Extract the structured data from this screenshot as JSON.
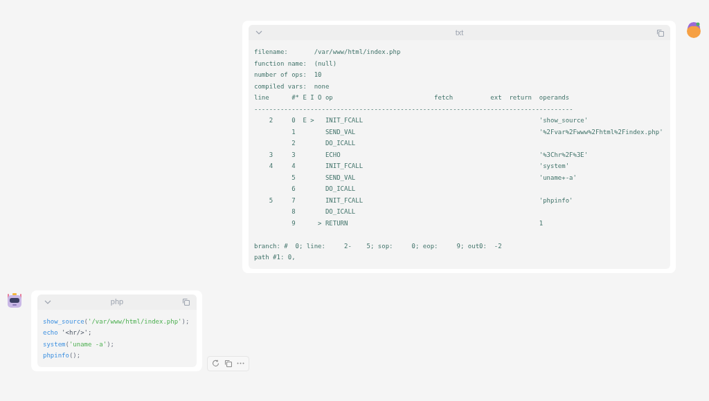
{
  "messages": [
    {
      "kind": "user",
      "code_block": {
        "language": "txt",
        "meta": [
          {
            "key": "filename:",
            "value": "/var/www/html/index.php"
          },
          {
            "key": "function name:",
            "value": "(null)"
          },
          {
            "key": "number of ops:",
            "value": "10"
          },
          {
            "key": "compiled vars:",
            "value": "none"
          }
        ],
        "header": "line      #* E I O op                           fetch          ext  return  operands",
        "rule": "-------------------------------------------------------------------------------------",
        "rows": [
          {
            "line": "2",
            "num": "0",
            "e": "E",
            "i": ">",
            "op": "INIT_FCALL",
            "operands": "'show_source'"
          },
          {
            "num": "1",
            "op": "SEND_VAL",
            "operands": "'%2Fvar%2Fwww%2Fhtml%2Findex.php'"
          },
          {
            "num": "2",
            "op": "DO_ICALL"
          },
          {
            "line": "3",
            "num": "3",
            "op": "ECHO",
            "operands": "'%3Chr%2F%3E'"
          },
          {
            "line": "4",
            "num": "4",
            "op": "INIT_FCALL",
            "operands": "'system'"
          },
          {
            "num": "5",
            "op": "SEND_VAL",
            "operands": "'uname+-a'"
          },
          {
            "num": "6",
            "op": "DO_ICALL"
          },
          {
            "line": "5",
            "num": "7",
            "op": "INIT_FCALL",
            "operands": "'phpinfo'"
          },
          {
            "num": "8",
            "op": "DO_ICALL"
          },
          {
            "num": "9",
            "o": ">",
            "op": "RETURN",
            "operands": "1"
          }
        ],
        "footer": [
          "branch: #  0; line:     2-    5; sop:     0; eop:     9; out0:  -2",
          "path #1: 0,"
        ]
      }
    },
    {
      "kind": "assistant",
      "code_block": {
        "language": "php",
        "lines": [
          [
            {
              "kind": "fn",
              "text": "show_source"
            },
            {
              "kind": "punc",
              "text": "("
            },
            {
              "kind": "str",
              "text": "'/var/www/html/index.php'"
            },
            {
              "kind": "punc",
              "text": ");"
            }
          ],
          [
            {
              "kind": "fn",
              "text": "echo"
            },
            {
              "kind": "plain",
              "text": " '<hr/>';"
            }
          ],
          [
            {
              "kind": "fn",
              "text": "system"
            },
            {
              "kind": "punc",
              "text": "("
            },
            {
              "kind": "str",
              "text": "'uname -a'"
            },
            {
              "kind": "punc",
              "text": ");"
            }
          ],
          [
            {
              "kind": "fn",
              "text": "phpinfo"
            },
            {
              "kind": "punc",
              "text": "();"
            }
          ]
        ]
      }
    }
  ]
}
